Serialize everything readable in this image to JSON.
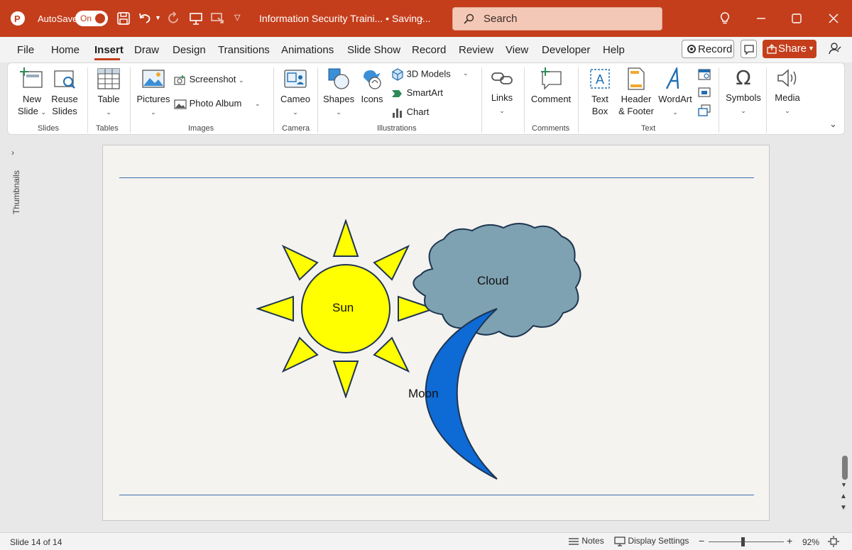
{
  "titlebar": {
    "autosave_label": "AutoSave",
    "autosave_state": "On",
    "document_title": "Information Security Traini...  •  Saving...",
    "search_placeholder": "Search"
  },
  "menu": {
    "tabs": [
      "File",
      "Home",
      "Insert",
      "Draw",
      "Design",
      "Transitions",
      "Animations",
      "Slide Show",
      "Record",
      "Review",
      "View",
      "Developer",
      "Help"
    ],
    "active_tab": "Insert",
    "record_label": "Record",
    "share_label": "Share"
  },
  "ribbon": {
    "slides": {
      "new_slide_1": "New",
      "new_slide_2": "Slide",
      "reuse_1": "Reuse",
      "reuse_2": "Slides",
      "group": "Slides"
    },
    "tables": {
      "table": "Table",
      "group": "Tables"
    },
    "images": {
      "pictures": "Pictures",
      "screenshot": "Screenshot",
      "photo_album": "Photo Album",
      "group": "Images"
    },
    "camera": {
      "cameo": "Cameo",
      "group": "Camera"
    },
    "illustrations": {
      "shapes": "Shapes",
      "icons": "Icons",
      "models": "3D Models",
      "smartart": "SmartArt",
      "chart": "Chart",
      "group": "Illustrations"
    },
    "links": {
      "links": "Links"
    },
    "comments": {
      "comment": "Comment",
      "group": "Comments"
    },
    "text": {
      "textbox_1": "Text",
      "textbox_2": "Box",
      "header_1": "Header",
      "header_2": "& Footer",
      "wordart": "WordArt",
      "group": "Text"
    },
    "symbols": {
      "symbols": "Symbols"
    },
    "media": {
      "media": "Media"
    }
  },
  "sidebar": {
    "thumbnails_label": "Thumbnails"
  },
  "slide": {
    "shapes": {
      "sun": "Sun",
      "cloud": "Cloud",
      "moon": "Moon"
    }
  },
  "status": {
    "slide_counter": "Slide 14 of 14",
    "notes": "Notes",
    "display_settings": "Display Settings",
    "zoom": "92%"
  },
  "colors": {
    "brand": "#c43e1c",
    "sun_fill": "#ffff00",
    "cloud_fill": "#7ea2b2",
    "moon_fill": "#0e6ad5",
    "outline": "#1f3550"
  }
}
